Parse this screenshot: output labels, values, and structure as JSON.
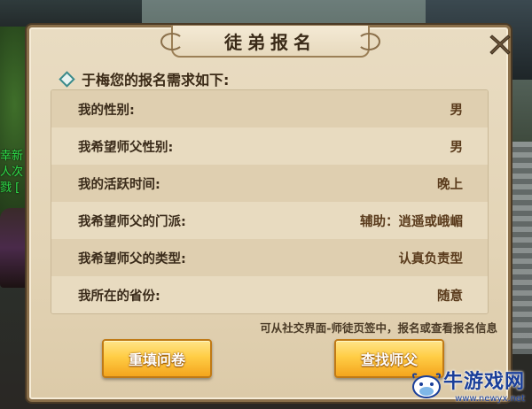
{
  "background": {
    "npc_text_lines": [
      "幸新",
      "人次",
      "戮 ["
    ]
  },
  "dialog": {
    "title": "徒弟报名",
    "section_heading": "于梅您的报名需求如下:",
    "rows": [
      {
        "label": "我的性别:",
        "value": "男"
      },
      {
        "label": "我希望师父性别:",
        "value": "男"
      },
      {
        "label": "我的活跃时间:",
        "value": "晚上"
      },
      {
        "label": "我希望师父的门派:",
        "value": "辅助：逍遥或峨嵋"
      },
      {
        "label": "我希望师父的类型:",
        "value": "认真负责型"
      },
      {
        "label": "我所在的省份:",
        "value": "随意"
      }
    ],
    "hint": "可从社交界面-师徒页签中，报名或查看报名信息",
    "buttons": {
      "refill": "重填问卷",
      "find_master": "查找师父"
    }
  },
  "watermark": {
    "name": "牛游戏网",
    "url": "www.newyx.net"
  },
  "colors": {
    "panel_bg": "#e9dcc2",
    "button_gold": "#ffcd45",
    "npc_name_green": "#2ee04a",
    "watermark_blue": "#1a3f9a"
  },
  "icons": {
    "close": "close-x-icon",
    "bullet": "diamond-bullet-icon",
    "watermark_logo": "cow-logo-icon"
  }
}
